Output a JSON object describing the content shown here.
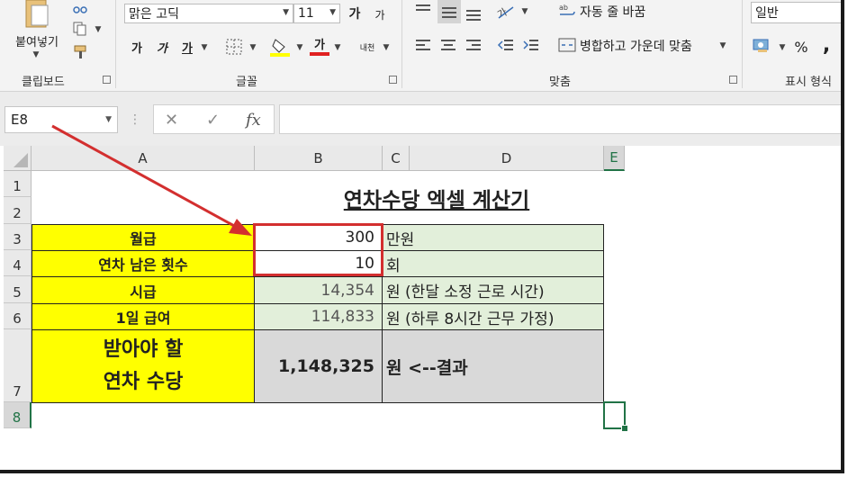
{
  "ribbon": {
    "clipboard": {
      "paste_label": "붙여넣기",
      "group_label": "클립보드"
    },
    "font": {
      "font_name": "맑은 고딕",
      "font_size": "11",
      "grow_label": "가",
      "shrink_label": "가",
      "bold_label": "가",
      "italic_label": "가",
      "underline_label": "가",
      "font_color_label": "가",
      "phonetic_label": "내천",
      "group_label": "글꼴"
    },
    "alignment": {
      "wrap_text_label": "자동 줄 바꿈",
      "merge_label": "병합하고 가운데 맞춤",
      "group_label": "맞춤"
    },
    "number": {
      "format_value": "일반",
      "percent_label": "%",
      "comma_label": ",",
      "group_label": "표시 형식"
    }
  },
  "formula_bar": {
    "name_box": "E8",
    "cancel_label": "✕",
    "enter_label": "✓",
    "fx_label": "fx",
    "formula": ""
  },
  "columns": [
    "A",
    "B",
    "C",
    "D",
    "E"
  ],
  "rows": [
    "1",
    "2",
    "3",
    "4",
    "5",
    "6",
    "7",
    "8"
  ],
  "sheet": {
    "title": "연차수당 엑셀 계산기",
    "salary_label": "월급",
    "salary_value": "300",
    "salary_unit": "만원",
    "leave_label": "연차 남은 횟수",
    "leave_value": "10",
    "leave_unit": "회",
    "hourly_label": "시급",
    "hourly_value": "14,354",
    "hourly_note": "원  (한달 소정 근로 시간)",
    "daily_label": "1일 급여",
    "daily_value": "114,833",
    "daily_note": "원  (하루 8시간 근무 가정)",
    "result_label_line1": "받아야 할",
    "result_label_line2": "연차 수당",
    "result_value": "1,148,325",
    "result_note": "원  <--결과"
  },
  "colors": {
    "input_highlight": "#ffff00",
    "computed_fill": "#e2efda",
    "result_fill": "#d9d9d9",
    "annotation": "#d32f2f",
    "selection": "#217346"
  }
}
